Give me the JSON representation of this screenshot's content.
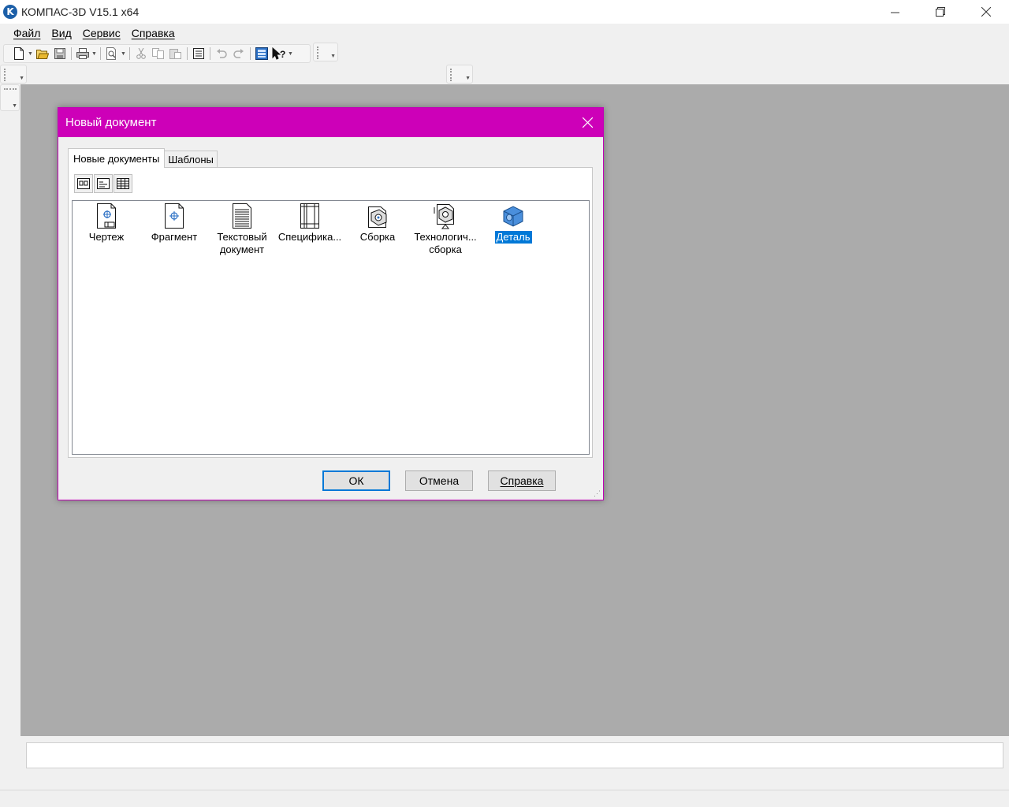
{
  "window": {
    "title": "КОМПАС-3D V15.1 x64",
    "logo_letter": "K",
    "controls": {
      "minimize": "—",
      "restore": "❐",
      "close": "✕"
    }
  },
  "menu": {
    "items": [
      {
        "label": "Файл"
      },
      {
        "label": "Вид"
      },
      {
        "label": "Сервис"
      },
      {
        "label": "Справка"
      }
    ]
  },
  "toolbar": {
    "buttons": [
      "new-document-icon",
      "open-folder-icon",
      "save-icon",
      "print-icon",
      "print-preview-icon",
      "cut-icon",
      "copy-icon",
      "paste-icon",
      "properties-icon",
      "undo-icon",
      "redo-icon",
      "manager-icon",
      "context-help-icon"
    ]
  },
  "dialog": {
    "title": "Новый документ",
    "close": "✕",
    "tabs": [
      {
        "label": "Новые документы",
        "active": true
      },
      {
        "label": "Шаблоны",
        "active": false
      }
    ],
    "view_modes": [
      "large-icons-icon",
      "list-view-icon",
      "details-view-icon"
    ],
    "documents": [
      {
        "label": "Чертеж",
        "icon": "drawing-icon",
        "selected": false
      },
      {
        "label": "Фрагмент",
        "icon": "fragment-icon",
        "selected": false
      },
      {
        "label": "Текстовый\nдокумент",
        "icon": "text-document-icon",
        "selected": false
      },
      {
        "label": "Специфика...",
        "icon": "specification-icon",
        "selected": false
      },
      {
        "label": "Сборка",
        "icon": "assembly-icon",
        "selected": false
      },
      {
        "label": "Технологич...\nсборка",
        "icon": "technological-assembly-icon",
        "selected": false
      },
      {
        "label": "Деталь",
        "icon": "part-icon",
        "selected": true
      }
    ],
    "buttons": {
      "ok": "ОК",
      "cancel": "Отмена",
      "help": "Справка"
    },
    "accent_color": "#cd00b8"
  },
  "colors": {
    "workspace": "#ababab",
    "selection": "#0078d7"
  }
}
